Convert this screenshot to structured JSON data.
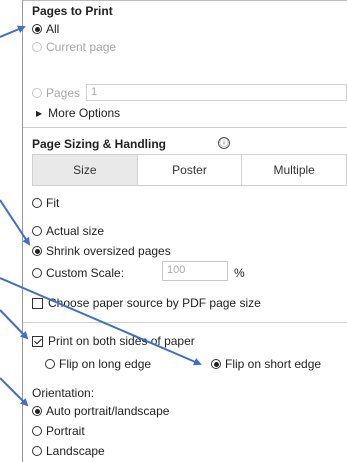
{
  "pages_to_print": {
    "title": "Pages to Print",
    "all_label": "All",
    "current_page_label": "Current page",
    "pages_label": "Pages",
    "pages_value": "1",
    "more_options_label": "More Options"
  },
  "page_sizing": {
    "title": "Page Sizing & Handling",
    "info_icon": "ⓘ",
    "tabs": [
      "Size",
      "Poster",
      "Multiple"
    ],
    "fit_label": "Fit",
    "actual_size_label": "Actual size",
    "shrink_label": "Shrink oversized pages",
    "custom_scale_label": "Custom Scale:",
    "custom_scale_value": "100",
    "percent_label": "%",
    "paper_source_label": "Choose paper source by PDF page size"
  },
  "duplex": {
    "both_sides_label": "Print on both sides of paper",
    "long_edge_label": "Flip on long edge",
    "short_edge_label": "Flip on short edge"
  },
  "orientation": {
    "title": "Orientation:",
    "auto_label": "Auto portrait/landscape",
    "portrait_label": "Portrait",
    "landscape_label": "Landscape"
  },
  "colors": {
    "arrow": "#3f6fc6",
    "accent": "#222222"
  },
  "icons": {
    "more_options": "triangle-right-icon",
    "info": "info-icon"
  }
}
